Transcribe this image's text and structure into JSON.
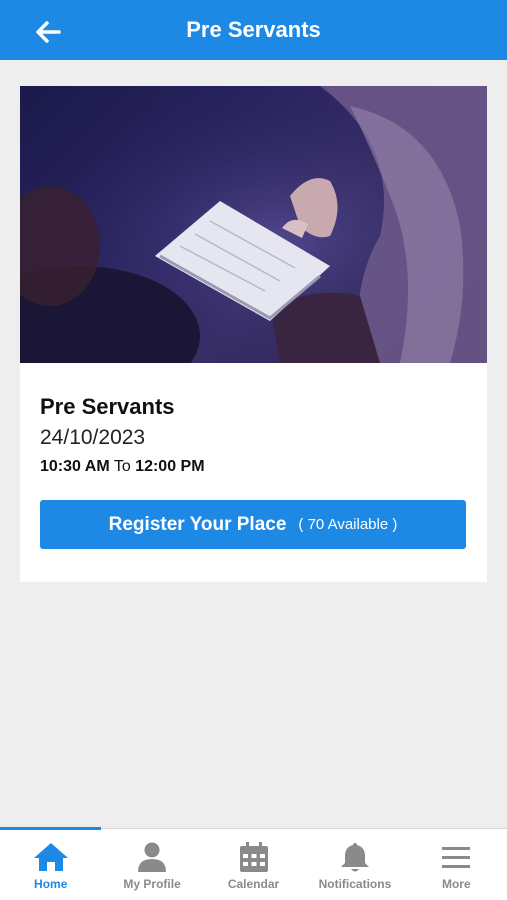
{
  "header": {
    "title": "Pre Servants"
  },
  "event": {
    "title": "Pre Servants",
    "date": "24/10/2023",
    "start_time": "10:30 AM",
    "time_separator": "To",
    "end_time": "12:00 PM",
    "register_label": "Register Your Place",
    "availability": "( 70 Available )"
  },
  "tabs": [
    {
      "label": "Home",
      "icon": "home-icon",
      "active": true
    },
    {
      "label": "My Profile",
      "icon": "person-icon",
      "active": false
    },
    {
      "label": "Calendar",
      "icon": "calendar-icon",
      "active": false
    },
    {
      "label": "Notifications",
      "icon": "bell-icon",
      "active": false
    },
    {
      "label": "More",
      "icon": "menu-icon",
      "active": false
    }
  ],
  "colors": {
    "primary": "#1e88e5",
    "inactive": "#8a8a8a",
    "background": "#eeeeee"
  }
}
